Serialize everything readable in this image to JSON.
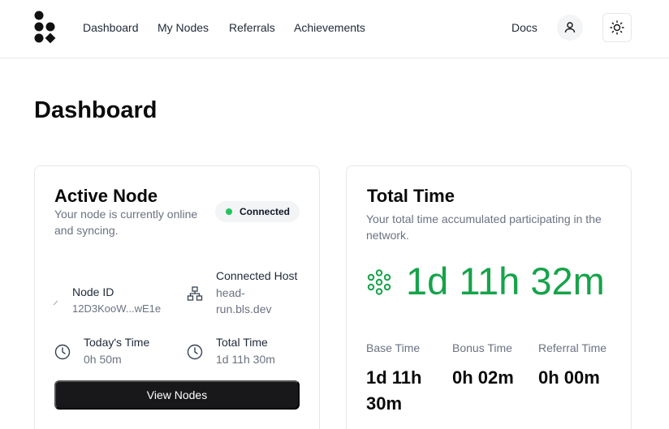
{
  "nav": {
    "items": [
      "Dashboard",
      "My Nodes",
      "Referrals",
      "Achievements"
    ],
    "docs": "Docs"
  },
  "page": {
    "title": "Dashboard"
  },
  "active_node": {
    "title": "Active Node",
    "description": "Your node is currently online and syncing.",
    "status": "Connected",
    "status_color": "#22c55e",
    "node_id_label": "Node ID",
    "node_id_value": "12D3KooW...wE1e",
    "host_label": "Connected Host",
    "host_value": "head-run.bls.dev",
    "today_label": "Today's Time",
    "today_value": "0h 50m",
    "total_label": "Total Time",
    "total_value": "1d 11h 30m",
    "button": "View Nodes"
  },
  "total_time": {
    "title": "Total Time",
    "description": "Your total time accumulated participating in the network.",
    "value": "1d 11h 32m",
    "value_color": "#16a34a",
    "base_label": "Base Time",
    "base_value": "1d 11h 30m",
    "bonus_label": "Bonus Time",
    "bonus_value": "0h 02m",
    "referral_label": "Referral Time",
    "referral_value": "0h 00m"
  }
}
